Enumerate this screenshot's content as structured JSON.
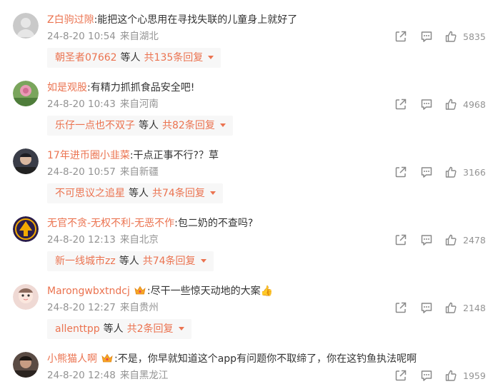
{
  "comments": [
    {
      "user": "Z白驹过隙",
      "text": ":能把这个心思用在寻找失联的儿童身上就好了",
      "time": "24-8-20 10:54",
      "location": "来自湖北",
      "likes": "5835",
      "reply_user": "朝圣者07662",
      "reply_mid": "等人",
      "reply_count": "共135条回复",
      "avatar_color": "#c9c9c9",
      "crown": false
    },
    {
      "user": "如是观股",
      "text": ":有精力抓抓食品安全吧!",
      "time": "24-8-20 10:43",
      "location": "来自河南",
      "likes": "4968",
      "reply_user": "乐仔一点也不双子",
      "reply_mid": "等人",
      "reply_count": "共82条回复",
      "avatar_color": "#7aa55c",
      "crown": false
    },
    {
      "user": "17年进币圈小韭菜",
      "text": ":干点正事不行?？草",
      "time": "24-8-20 10:57",
      "location": "来自新疆",
      "likes": "3166",
      "reply_user": "不可思议之追星",
      "reply_mid": "等人",
      "reply_count": "共74条回复",
      "avatar_color": "#3a3d48",
      "crown": false
    },
    {
      "user": "无官不贪-无权不利-无恶不作",
      "text": ":包二奶的不查吗?",
      "time": "24-8-20 12:13",
      "location": "来自北京",
      "likes": "2478",
      "reply_user": "新一线城市zz",
      "reply_mid": "等人",
      "reply_count": "共74条回复",
      "avatar_color": "#2b1d4a",
      "crown": false
    },
    {
      "user": "Marongwbxtndcj",
      "text": ":尽干一些惊天动地的大案👍",
      "time": "24-8-20 12:27",
      "location": "来自贵州",
      "likes": "2148",
      "reply_user": "allenttpp",
      "reply_mid": "等人",
      "reply_count": "共2条回复",
      "avatar_color": "#efd9d4",
      "crown": true
    },
    {
      "user": "小熊猫人啊",
      "text": ":不是，你早就知道这个app有问题你不取缔了，你在这钓鱼执法呢啊",
      "time": "24-8-20 12:48",
      "location": "来自黑龙江",
      "likes": "1959",
      "avatar_color": "#5a4b44",
      "crown": true
    }
  ],
  "colors": {
    "username": "#eb7350",
    "meta": "#939393",
    "reply_bg": "#f7f7f7"
  }
}
